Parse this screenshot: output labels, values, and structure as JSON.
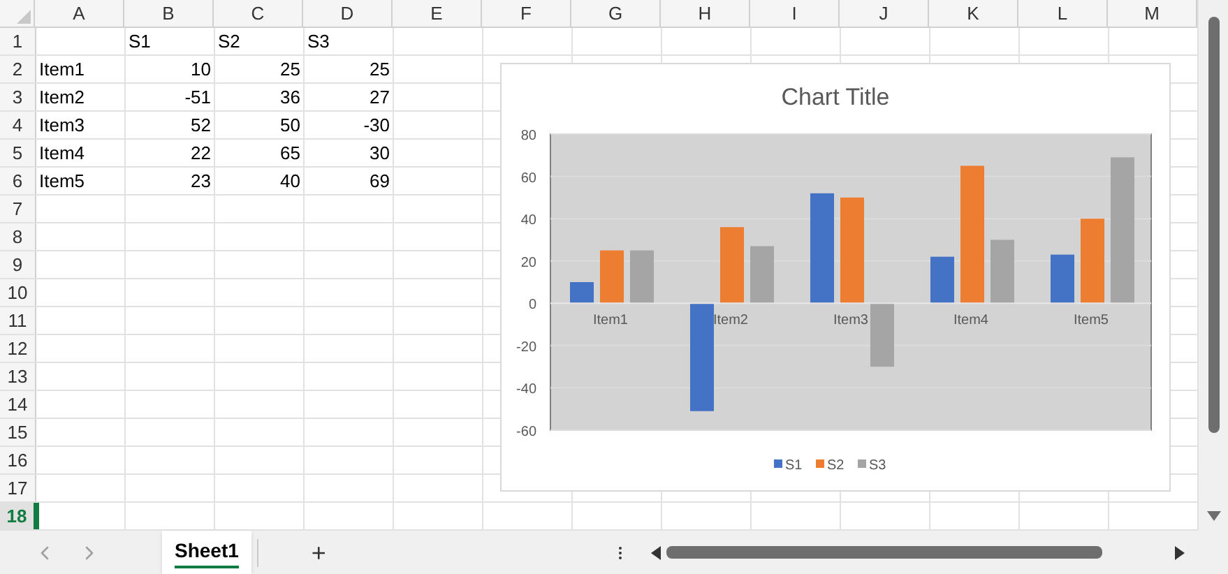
{
  "columns": [
    "A",
    "B",
    "C",
    "D",
    "E",
    "F",
    "G",
    "H",
    "I",
    "J",
    "K",
    "L",
    "M"
  ],
  "rows": [
    {
      "label": "1",
      "selected": false,
      "cells": [
        {
          "kind": "empty"
        },
        {
          "text": "S1",
          "kind": "text"
        },
        {
          "text": "S2",
          "kind": "text"
        },
        {
          "text": "S3",
          "kind": "text"
        }
      ]
    },
    {
      "label": "2",
      "selected": false,
      "cells": [
        {
          "text": "Item1",
          "kind": "text"
        },
        {
          "text": "10",
          "kind": "number"
        },
        {
          "text": "25",
          "kind": "number"
        },
        {
          "text": "25",
          "kind": "number"
        }
      ]
    },
    {
      "label": "3",
      "selected": false,
      "cells": [
        {
          "text": "Item2",
          "kind": "text"
        },
        {
          "text": "-51",
          "kind": "number"
        },
        {
          "text": "36",
          "kind": "number"
        },
        {
          "text": "27",
          "kind": "number"
        }
      ]
    },
    {
      "label": "4",
      "selected": false,
      "cells": [
        {
          "text": "Item3",
          "kind": "text"
        },
        {
          "text": "52",
          "kind": "number"
        },
        {
          "text": "50",
          "kind": "number"
        },
        {
          "text": "-30",
          "kind": "number"
        }
      ]
    },
    {
      "label": "5",
      "selected": false,
      "cells": [
        {
          "text": "Item4",
          "kind": "text"
        },
        {
          "text": "22",
          "kind": "number"
        },
        {
          "text": "65",
          "kind": "number"
        },
        {
          "text": "30",
          "kind": "number"
        }
      ]
    },
    {
      "label": "6",
      "selected": false,
      "cells": [
        {
          "text": "Item5",
          "kind": "text"
        },
        {
          "text": "23",
          "kind": "number"
        },
        {
          "text": "40",
          "kind": "number"
        },
        {
          "text": "69",
          "kind": "number"
        }
      ]
    },
    {
      "label": "7",
      "selected": false,
      "cells": []
    },
    {
      "label": "8",
      "selected": false,
      "cells": []
    },
    {
      "label": "9",
      "selected": false,
      "cells": []
    },
    {
      "label": "10",
      "selected": false,
      "cells": []
    },
    {
      "label": "11",
      "selected": false,
      "cells": []
    },
    {
      "label": "12",
      "selected": false,
      "cells": []
    },
    {
      "label": "13",
      "selected": false,
      "cells": []
    },
    {
      "label": "14",
      "selected": false,
      "cells": []
    },
    {
      "label": "15",
      "selected": false,
      "cells": []
    },
    {
      "label": "16",
      "selected": false,
      "cells": []
    },
    {
      "label": "17",
      "selected": false,
      "cells": []
    },
    {
      "label": "18",
      "selected": true,
      "cells": []
    }
  ],
  "chart": {
    "chart_data": {
      "type": "bar",
      "title": "Chart Title",
      "categories": [
        "Item1",
        "Item2",
        "Item3",
        "Item4",
        "Item5"
      ],
      "series": [
        {
          "name": "S1",
          "color": "#4472c4",
          "values": [
            10,
            -51,
            52,
            22,
            23
          ]
        },
        {
          "name": "S2",
          "color": "#ed7d31",
          "values": [
            25,
            36,
            50,
            65,
            40
          ]
        },
        {
          "name": "S3",
          "color": "#a5a5a5",
          "values": [
            25,
            27,
            -30,
            30,
            69
          ]
        }
      ],
      "ylim": [
        -60,
        80
      ],
      "yticks": [
        {
          "value": -60,
          "label": "-60"
        },
        {
          "value": -40,
          "label": "-40"
        },
        {
          "value": -20,
          "label": "-20"
        },
        {
          "value": 0,
          "label": "0"
        },
        {
          "value": 20,
          "label": "20"
        },
        {
          "value": 40,
          "label": "40"
        },
        {
          "value": 60,
          "label": "60"
        },
        {
          "value": 80,
          "label": "80"
        }
      ],
      "grid": true,
      "legend": true
    }
  },
  "sheet_tabs": [
    {
      "label": "Sheet1",
      "selected": true
    }
  ],
  "add_sheet": "+"
}
